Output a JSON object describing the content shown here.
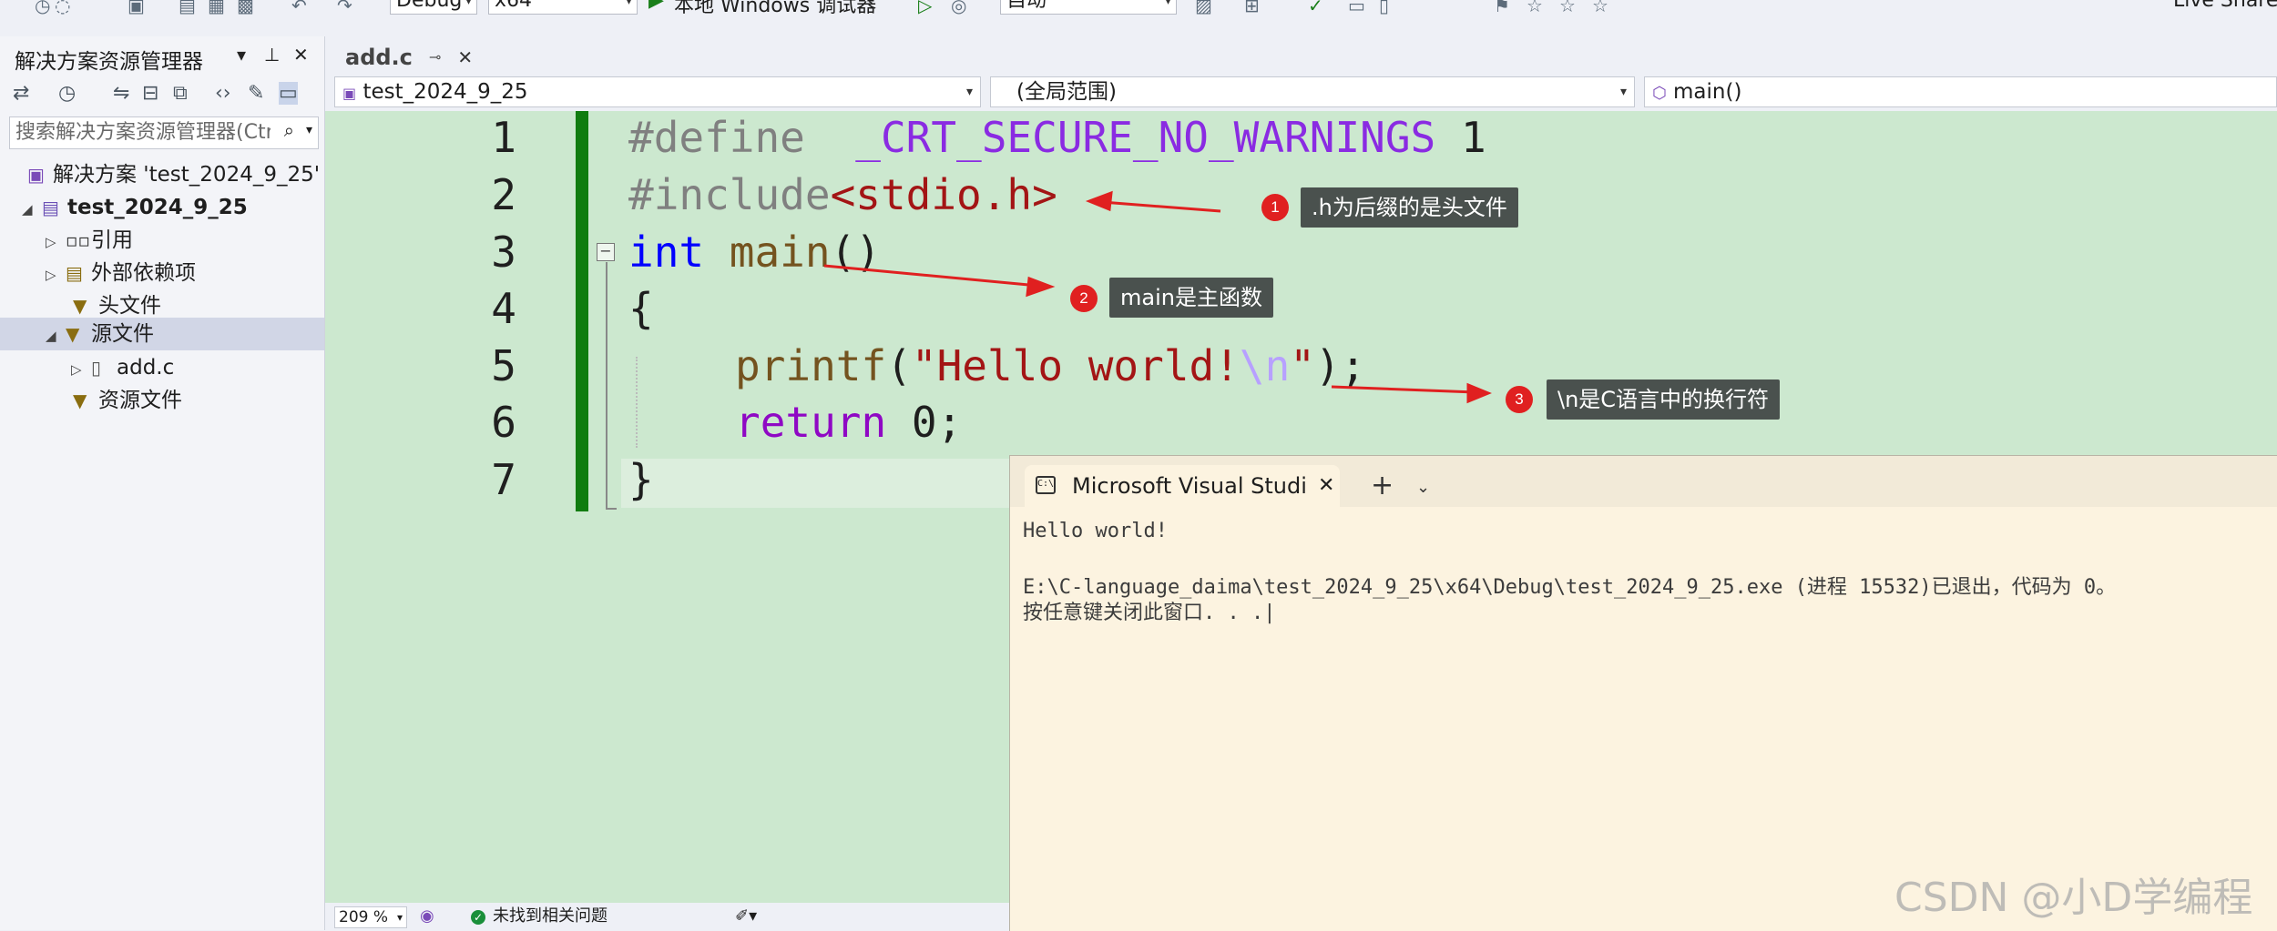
{
  "toolbar": {
    "config": "Debug",
    "platform": "x64",
    "debugger": "本地 Windows 调试器",
    "auto": "自动",
    "live_share": "Live Share"
  },
  "solution_explorer": {
    "title": "解决方案资源管理器",
    "search_placeholder": "搜索解决方案资源管理器(Ctrl+;)",
    "tree": [
      {
        "label": "解决方案 'test_2024_9_25'"
      },
      {
        "label": "test_2024_9_25"
      },
      {
        "label": "引用"
      },
      {
        "label": "外部依赖项"
      },
      {
        "label": "头文件"
      },
      {
        "label": "源文件"
      },
      {
        "label": "add.c"
      },
      {
        "label": "资源文件"
      }
    ]
  },
  "editor": {
    "tab": "add.c",
    "nav_project": "test_2024_9_25",
    "nav_scope": "(全局范围)",
    "nav_member": "main()",
    "line_numbers": [
      "1",
      "2",
      "3",
      "4",
      "5",
      "6",
      "7"
    ],
    "code": {
      "l1_directive": "#define",
      "l1_macro": "_CRT_SECURE_NO_WARNINGS",
      "l1_value": "1",
      "l2_directive": "#include",
      "l2_header": "<stdio.h>",
      "l3_type": "int",
      "l3_name": "main",
      "l3_parens": "()",
      "l4": "{",
      "l5_func": "printf",
      "l5_open": "(",
      "l5_str1": "\"Hello world!",
      "l5_esc": "\\n",
      "l5_str2": "\"",
      "l5_close": ");",
      "l6_kw": "return",
      "l6_rest": "0;",
      "l7": "}"
    }
  },
  "annotations": [
    {
      "num": "1",
      "text": ".h为后缀的是头文件"
    },
    {
      "num": "2",
      "text": "main是主函数"
    },
    {
      "num": "3",
      "text": "\\n是C语言中的换行符"
    }
  ],
  "status": {
    "zoom": "209 %",
    "issues": "未找到相关问题"
  },
  "terminal": {
    "tab_title": "Microsoft Visual Studi",
    "lines": [
      "Hello world!",
      "",
      "E:\\C-language_daima\\test_2024_9_25\\x64\\Debug\\test_2024_9_25.exe (进程 15532)已退出，代码为 0。",
      "按任意键关闭此窗口. . .|"
    ]
  },
  "watermark": "CSDN @小D学编程",
  "colors": {
    "editor_bg": "#cce8cf",
    "change_bar": "#107c10",
    "terminal_bg": "#fcf3e0",
    "annotation_badge": "#e02020",
    "annotation_box": "#4a514e"
  }
}
